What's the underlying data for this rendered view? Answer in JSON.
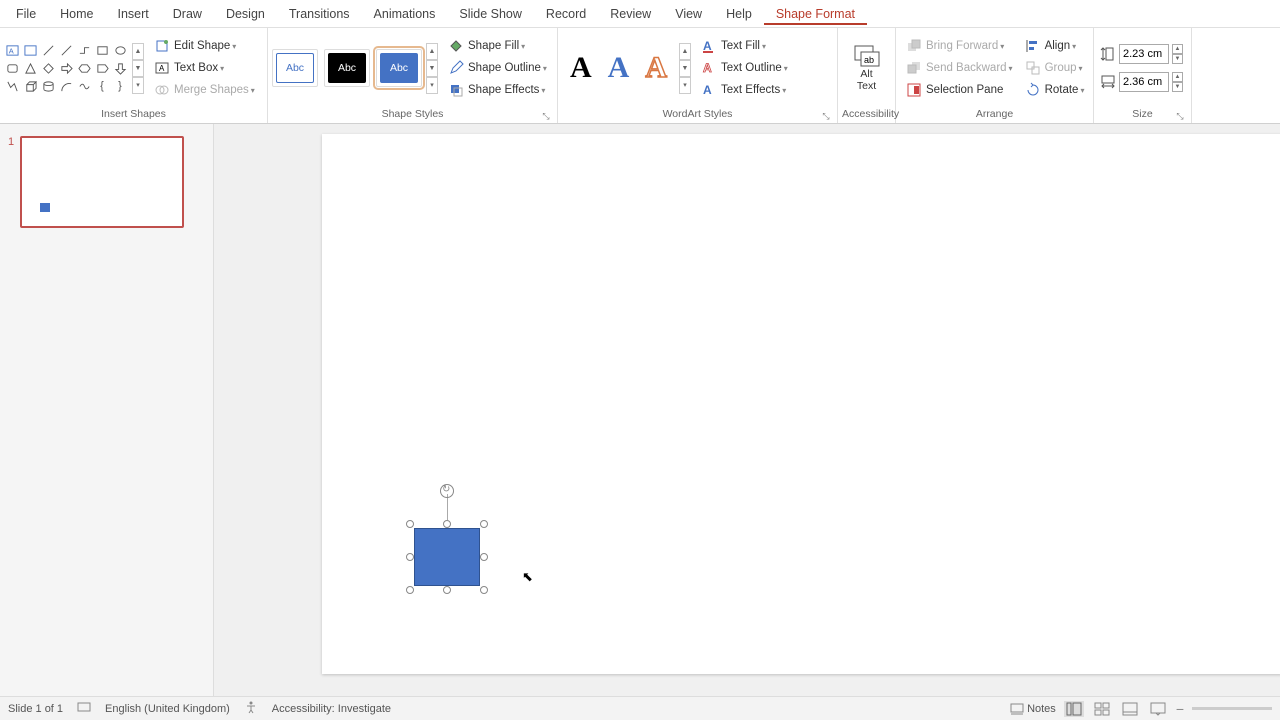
{
  "menu": {
    "items": [
      "File",
      "Home",
      "Insert",
      "Draw",
      "Design",
      "Transitions",
      "Animations",
      "Slide Show",
      "Record",
      "Review",
      "View",
      "Help",
      "Shape Format"
    ],
    "active": "Shape Format"
  },
  "ribbon": {
    "insertShapes": {
      "label": "Insert Shapes",
      "editShape": "Edit Shape",
      "textBox": "Text Box",
      "mergeShapes": "Merge Shapes"
    },
    "shapeStyles": {
      "label": "Shape Styles",
      "presetLabel": "Abc",
      "shapeFill": "Shape Fill",
      "shapeOutline": "Shape Outline",
      "shapeEffects": "Shape Effects"
    },
    "wordArt": {
      "label": "WordArt Styles",
      "glyph": "A",
      "textFill": "Text Fill",
      "textOutline": "Text Outline",
      "textEffects": "Text Effects"
    },
    "accessibility": {
      "label": "Accessibility",
      "altText1": "Alt",
      "altText2": "Text"
    },
    "arrange": {
      "label": "Arrange",
      "bringForward": "Bring Forward",
      "sendBackward": "Send Backward",
      "selectionPane": "Selection Pane",
      "align": "Align",
      "group": "Group",
      "rotate": "Rotate"
    },
    "size": {
      "label": "Size",
      "height": "2.23 cm",
      "width": "2.36 cm"
    }
  },
  "thumb": {
    "num": "1"
  },
  "status": {
    "slideCount": "Slide 1 of 1",
    "language": "English (United Kingdom)",
    "accessibility": "Accessibility: Investigate",
    "notes": "Notes"
  }
}
